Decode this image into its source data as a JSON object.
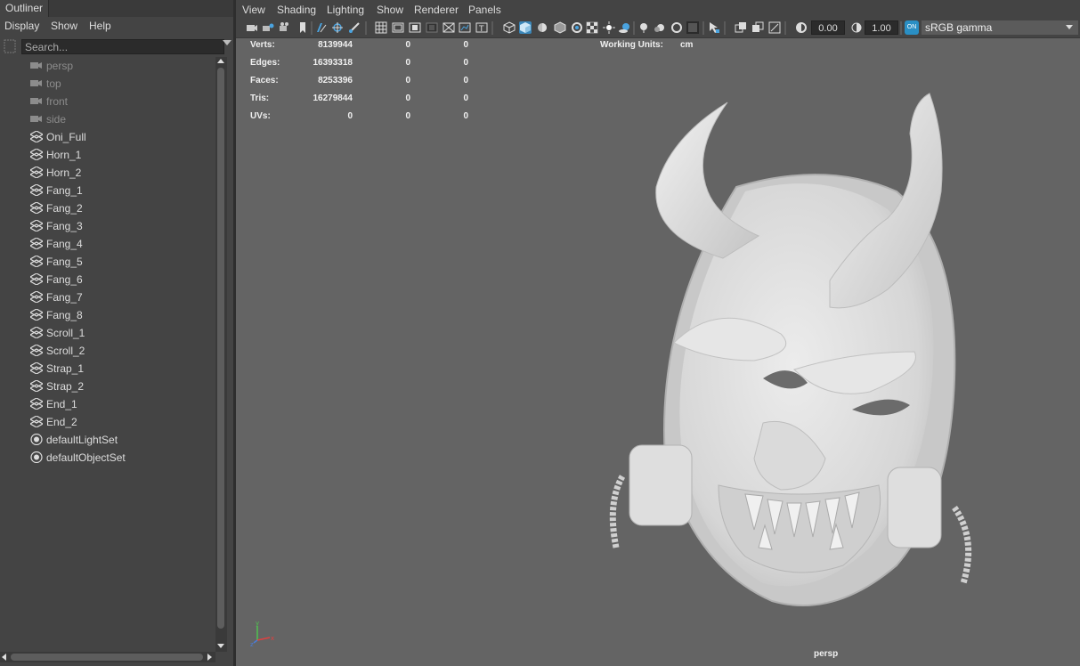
{
  "outliner": {
    "tab_title": "Outliner",
    "menu": [
      "Display",
      "Show",
      "Help"
    ],
    "search_placeholder": "Search...",
    "items": [
      {
        "label": "persp",
        "type": "camera",
        "dim": true
      },
      {
        "label": "top",
        "type": "camera",
        "dim": true
      },
      {
        "label": "front",
        "type": "camera",
        "dim": true
      },
      {
        "label": "side",
        "type": "camera",
        "dim": true
      },
      {
        "label": "Oni_Full",
        "type": "mesh",
        "dim": false
      },
      {
        "label": "Horn_1",
        "type": "mesh",
        "dim": false
      },
      {
        "label": "Horn_2",
        "type": "mesh",
        "dim": false
      },
      {
        "label": "Fang_1",
        "type": "mesh",
        "dim": false
      },
      {
        "label": "Fang_2",
        "type": "mesh",
        "dim": false
      },
      {
        "label": "Fang_3",
        "type": "mesh",
        "dim": false
      },
      {
        "label": "Fang_4",
        "type": "mesh",
        "dim": false
      },
      {
        "label": "Fang_5",
        "type": "mesh",
        "dim": false
      },
      {
        "label": "Fang_6",
        "type": "mesh",
        "dim": false
      },
      {
        "label": "Fang_7",
        "type": "mesh",
        "dim": false
      },
      {
        "label": "Fang_8",
        "type": "mesh",
        "dim": false
      },
      {
        "label": "Scroll_1",
        "type": "mesh",
        "dim": false
      },
      {
        "label": "Scroll_2",
        "type": "mesh",
        "dim": false
      },
      {
        "label": "Strap_1",
        "type": "mesh",
        "dim": false
      },
      {
        "label": "Strap_2",
        "type": "mesh",
        "dim": false
      },
      {
        "label": "End_1",
        "type": "mesh",
        "dim": false
      },
      {
        "label": "End_2",
        "type": "mesh",
        "dim": false
      },
      {
        "label": "defaultLightSet",
        "type": "set",
        "dim": false
      },
      {
        "label": "defaultObjectSet",
        "type": "set",
        "dim": false
      }
    ]
  },
  "viewport": {
    "menu": [
      "View",
      "Shading",
      "Lighting",
      "Show",
      "Renderer",
      "Panels"
    ],
    "exposure": "0.00",
    "gamma": "1.00",
    "color_space_toggle": "ON",
    "color_space": "sRGB gamma",
    "camera": "persp",
    "hud": {
      "rows": [
        {
          "label": "Verts:",
          "v1": "8139944",
          "v2": "0",
          "v3": "0"
        },
        {
          "label": "Edges:",
          "v1": "16393318",
          "v2": "0",
          "v3": "0"
        },
        {
          "label": "Faces:",
          "v1": "8253396",
          "v2": "0",
          "v3": "0"
        },
        {
          "label": "Tris:",
          "v1": "16279844",
          "v2": "0",
          "v3": "0"
        },
        {
          "label": "UVs:",
          "v1": "0",
          "v2": "0",
          "v3": "0"
        }
      ],
      "working_units_label": "Working Units:",
      "working_units_value": "cm"
    }
  },
  "colors": {
    "panel_bg": "#444444",
    "viewport_bg": "#646464",
    "accent_blue": "#2a8fc4",
    "model_color": "#d9d9d9"
  }
}
